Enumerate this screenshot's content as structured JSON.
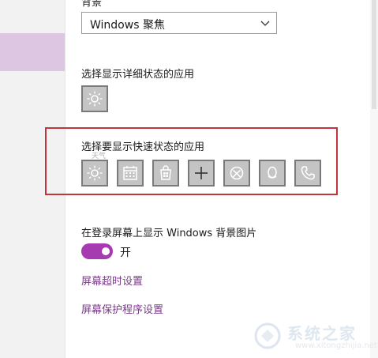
{
  "background_section": {
    "title": "背景",
    "dropdown_value": "Windows 聚焦"
  },
  "detailed_status": {
    "label": "选择显示详细状态的应用",
    "app_icon": "weather-sun-icon"
  },
  "quick_status": {
    "label": "选择要显示快速状态的应用",
    "caption": "天气",
    "apps": [
      {
        "icon": "weather-sun-icon"
      },
      {
        "icon": "calendar-icon"
      },
      {
        "icon": "store-icon"
      },
      {
        "icon": "plus-icon"
      },
      {
        "icon": "xbox-icon"
      },
      {
        "icon": "qq-penguin-icon"
      },
      {
        "icon": "phone-icon"
      }
    ]
  },
  "lockscreen_background": {
    "label": "在登录屏幕上显示 Windows 背景图片",
    "toggle_state": "开",
    "toggle_on": true
  },
  "links": {
    "screen_timeout": "屏幕超时设置",
    "screensaver": "屏幕保护程序设置"
  },
  "watermark": {
    "text": "系统之家",
    "url": "www.xitongzhijia.net"
  },
  "colors": {
    "accent": "#a63ab0",
    "highlight": "#c4343c",
    "link": "#7a3a88",
    "tile_bg": "#c4c4c4"
  }
}
